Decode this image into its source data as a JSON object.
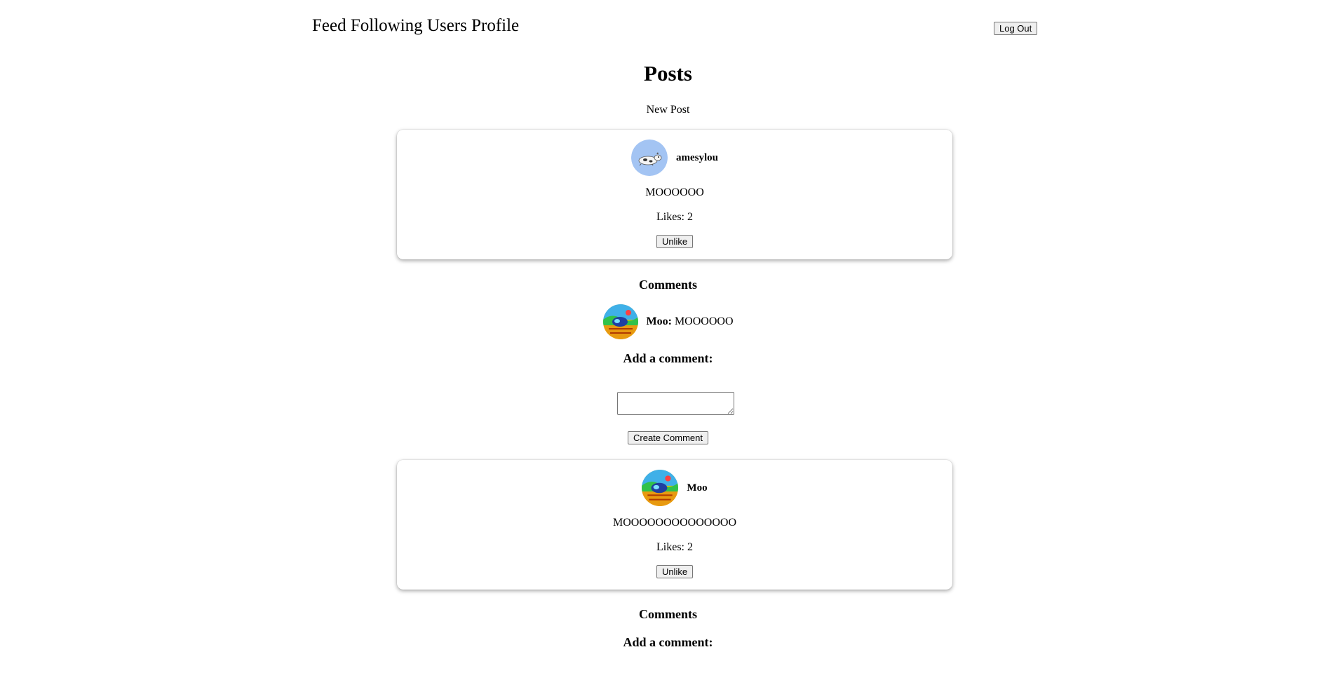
{
  "nav": {
    "items": [
      "Feed",
      "Following",
      "Users",
      "Profile"
    ],
    "logout_label": "Log Out"
  },
  "page": {
    "title": "Posts",
    "new_post_label": "New Post"
  },
  "posts": [
    {
      "author": "amesylou",
      "avatar_icon": "cow-lying-avatar-icon",
      "body": "MOOOOOO",
      "likes": "Likes: 2",
      "unlike_label": "Unlike",
      "comments_heading": "Comments",
      "comments": [
        {
          "author": "Moo:",
          "text": "MOOOOOO",
          "avatar_icon": "cow-field-avatar-icon"
        }
      ],
      "add_comment_heading": "Add a comment:",
      "comment_value": "",
      "create_comment_label": "Create Comment"
    },
    {
      "author": "Moo",
      "avatar_icon": "cow-field-avatar-icon",
      "body": "MOOOOOOOOOOOOOO",
      "likes": "Likes: 2",
      "unlike_label": "Unlike",
      "comments_heading": "Comments",
      "comments": [],
      "add_comment_heading": "Add a comment:",
      "comment_value": ""
    }
  ],
  "colors": {
    "background": "#ffffff",
    "button_bg": "#efefef",
    "button_border": "#767676",
    "avatar_blue": "#a3c4f3"
  }
}
